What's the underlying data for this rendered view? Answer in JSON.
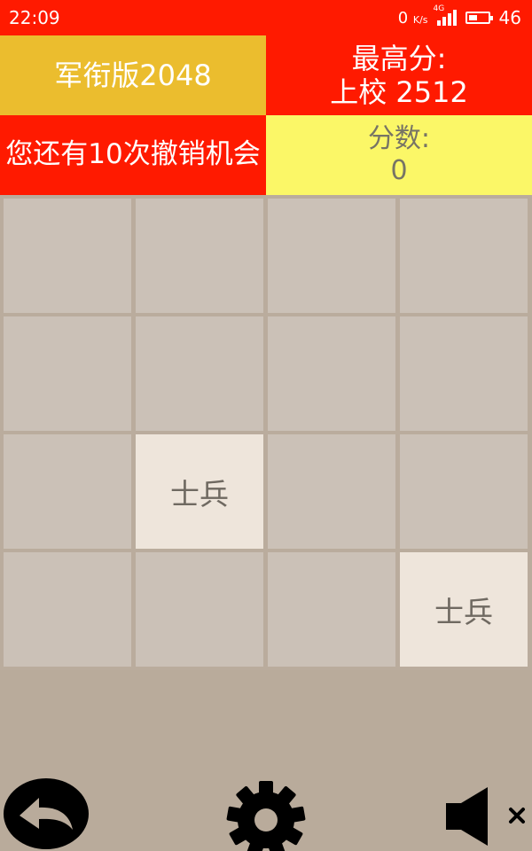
{
  "status_bar": {
    "time": "22:09",
    "net_speed_value": "0",
    "net_speed_unit": "K/s",
    "network_tag": "4G",
    "battery_level": "46"
  },
  "header": {
    "title": "军衔版2048",
    "best_label": "最高分:",
    "best_value": "上校 2512",
    "undo_text": "您还有10次撤销机会",
    "score_label": "分数:",
    "score_value": "0"
  },
  "board": {
    "rows": [
      [
        "",
        "",
        "",
        ""
      ],
      [
        "",
        "",
        "",
        ""
      ],
      [
        "",
        "士兵",
        "",
        ""
      ],
      [
        "",
        "",
        "",
        "士兵"
      ]
    ]
  },
  "controls": {
    "back_icon": "undo-arrow-icon",
    "settings_icon": "gear-icon",
    "sound_icon": "speaker-muted-icon"
  },
  "colors": {
    "status_bar": "#ff1a00",
    "title_panel": "#ebbd2e",
    "best_panel": "#ff1a00",
    "undo_panel": "#ff1a00",
    "score_panel": "#fbf767",
    "board_bg": "#baac9d",
    "empty_cell": "#cbc1b7",
    "tile_soldier": "#eee5db"
  }
}
